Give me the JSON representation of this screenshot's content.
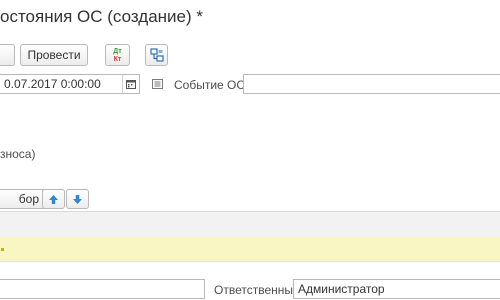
{
  "header": {
    "title": "остояния ОС (создание) *"
  },
  "toolbar": {
    "post_label": "Провести",
    "dtkt_top": "Дт",
    "dtkt_bottom": "Кт",
    "structure_icon": "structure-icon"
  },
  "form": {
    "date_value": "0.07.2017  0:00:00",
    "calendar_icon": "calendar-icon",
    "event_label": "Событие ОС:",
    "event_value": "",
    "depreciation_text": "зноса)"
  },
  "table_toolbar": {
    "select_label": "бор",
    "move_up_icon": "arrow-up-icon",
    "move_down_icon": "arrow-down-icon"
  },
  "footer": {
    "comment_value": "",
    "responsible_label": "Ответственный:",
    "responsible_value": "Администратор"
  },
  "colors": {
    "selected_row": "#faf6c4",
    "arrow_blue": "#2f86d2",
    "dt_green": "#2f9e2f",
    "kt_red": "#d23b3b"
  }
}
